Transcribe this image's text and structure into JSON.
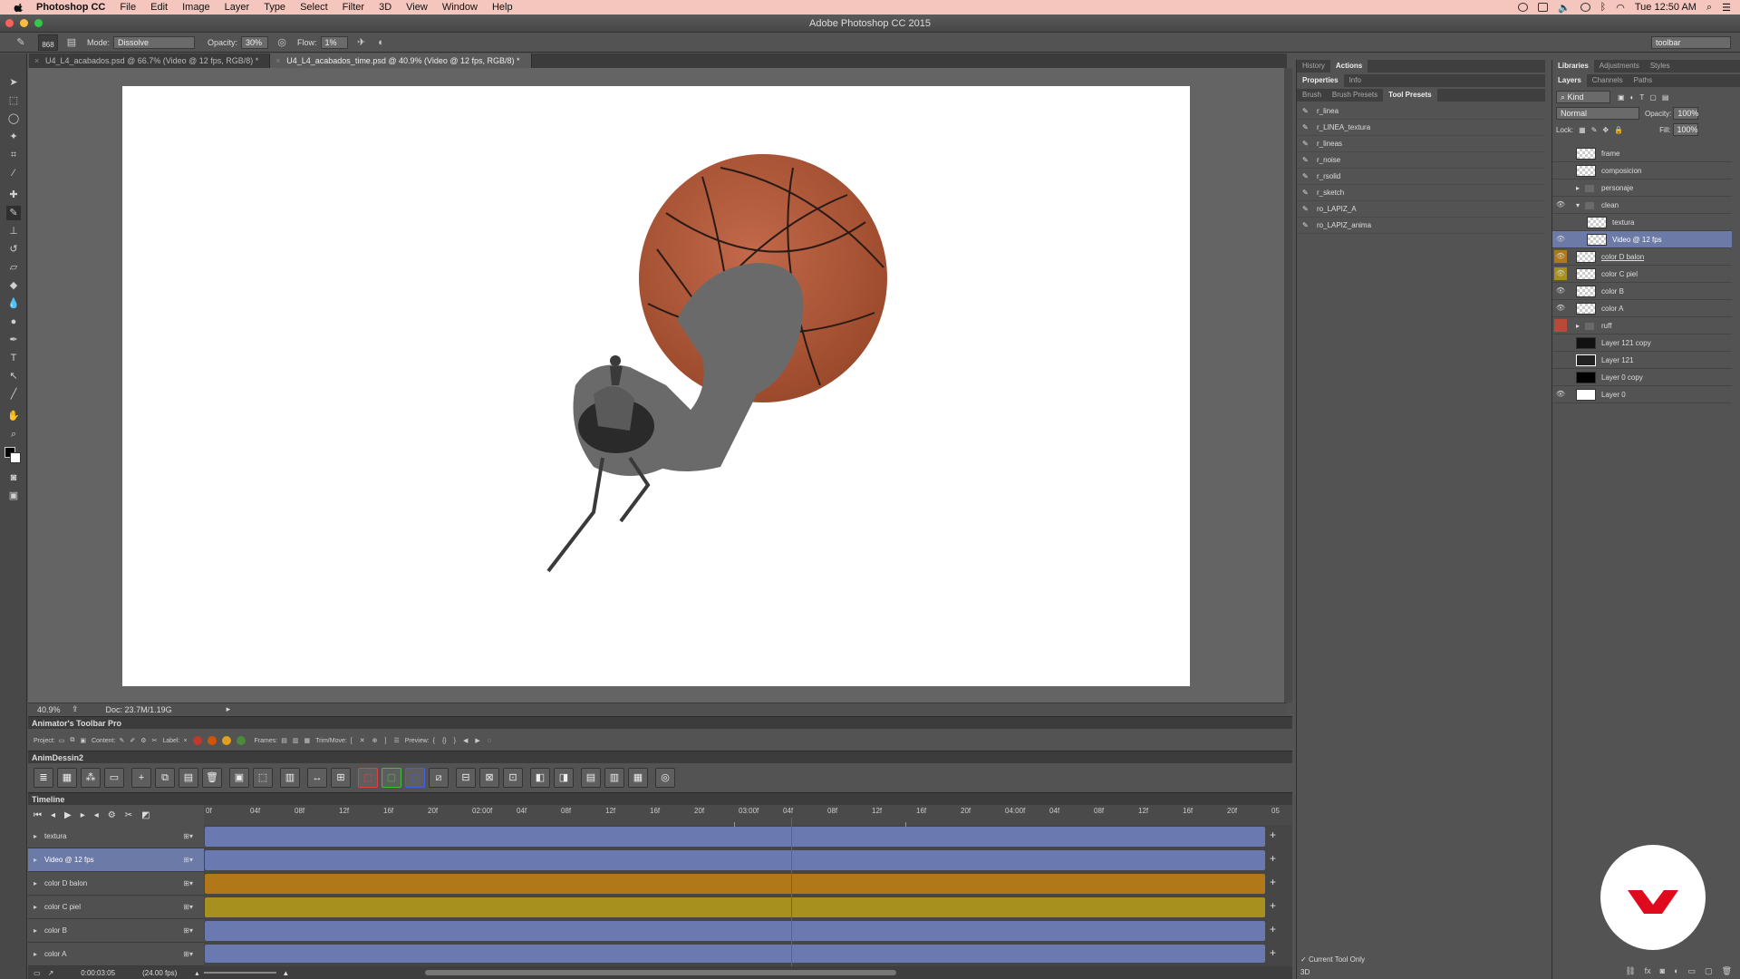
{
  "menubar": {
    "items": [
      "Photoshop CC",
      "File",
      "Edit",
      "Image",
      "Layer",
      "Type",
      "Select",
      "Filter",
      "3D",
      "View",
      "Window",
      "Help"
    ],
    "clock": "Tue 12:50 AM"
  },
  "window": {
    "title": "Adobe Photoshop CC 2015"
  },
  "options": {
    "brush_size": "868",
    "mode_label": "Mode:",
    "mode_value": "Dissolve",
    "opacity_label": "Opacity:",
    "opacity_value": "30%",
    "flow_label": "Flow:",
    "flow_value": "1%",
    "workspace": "toolbar"
  },
  "doc_tabs": [
    "U4_L4_acabados.psd @ 66.7% (Video @ 12 fps, RGB/8) *",
    "U4_L4_acabados_time.psd @ 40.9% (Video @ 12 fps, RGB/8) *"
  ],
  "status": {
    "zoom": "40.9%",
    "doc": "Doc: 23.7M/1.19G"
  },
  "animator": {
    "title": "Animator's Toolbar Pro",
    "project_label": "Project:",
    "content_label": "Content:",
    "label_label": "Label:",
    "frames_label": "Frames:",
    "trim_label": "Trim/Move:",
    "preview_label": "Preview:",
    "label_colors": [
      "#c0392b",
      "#d35400",
      "#e0a020",
      "#4a8a3a"
    ]
  },
  "animdessin": {
    "title": "AnimDessin2"
  },
  "timeline": {
    "title": "Timeline",
    "ruler": [
      "0f",
      "04f",
      "08f",
      "12f",
      "16f",
      "20f",
      "02:00f",
      "04f",
      "08f",
      "12f",
      "16f",
      "20f",
      "03:00f",
      "04f",
      "08f",
      "12f",
      "16f",
      "20f",
      "04:00f",
      "04f",
      "08f",
      "12f",
      "16f",
      "20f",
      "05"
    ],
    "rows": [
      {
        "name": "textura",
        "color": "#6a7ab0"
      },
      {
        "name": "Video @ 12 fps",
        "color": "#6a7ab0"
      },
      {
        "name": "color D balon",
        "color": "#b07818"
      },
      {
        "name": "color C piel",
        "color": "#a8901e"
      },
      {
        "name": "color B",
        "color": "#6a7ab0"
      },
      {
        "name": "color A",
        "color": "#6a7ab0"
      }
    ],
    "current_time": "0:00:03:05",
    "fps": "(24.00 fps)"
  },
  "mid_panel": {
    "tabs_top": [
      "History",
      "Actions"
    ],
    "tabs_mid": [
      "Properties",
      "Info"
    ],
    "tabs_low": [
      "Brush",
      "Brush Presets",
      "Tool Presets"
    ],
    "presets": [
      "r_linea",
      "r_LINEA_textura",
      "r_lineas",
      "r_noise",
      "r_rsolid",
      "r_sketch",
      "ro_LAPIZ_A",
      "ro_LAPIZ_anima"
    ],
    "current_tool_only": "Current Tool Only"
  },
  "right_panel": {
    "tabs_top": [
      "Libraries",
      "Adjustments",
      "Styles"
    ],
    "tabs_mid": [
      "Layers",
      "Channels",
      "Paths"
    ],
    "kind": "Kind",
    "blend": "Normal",
    "opacity_label": "Opacity:",
    "opacity_value": "100%",
    "lock_label": "Lock:",
    "fill_label": "Fill:",
    "fill_value": "100%",
    "layers": [
      {
        "name": "frame",
        "type": "checker"
      },
      {
        "name": "composicion",
        "type": "checker"
      },
      {
        "name": "personaje",
        "type": "folder"
      },
      {
        "name": "clean",
        "type": "folder"
      },
      {
        "name": "textura",
        "type": "checker"
      },
      {
        "name": "Video @ 12 fps",
        "type": "checker"
      },
      {
        "name": "color D balon",
        "type": "checker"
      },
      {
        "name": "color C piel",
        "type": "checker"
      },
      {
        "name": "color B",
        "type": "checker"
      },
      {
        "name": "color A",
        "type": "checker"
      },
      {
        "name": "ruff",
        "type": "folder"
      },
      {
        "name": "Layer 121 copy",
        "type": "dark"
      },
      {
        "name": "Layer 121",
        "type": "dark"
      },
      {
        "name": "Layer 0 copy",
        "type": "black"
      },
      {
        "name": "Layer 0",
        "type": "white"
      }
    ]
  },
  "bottom_left": "3D",
  "colors": {
    "timeline_blue": "#6a7ab0",
    "timeline_orange": "#b07818",
    "timeline_gold": "#a8901e",
    "ball": "#b05a38",
    "figure": "#6a6a6a",
    "logo_red": "#e00a1e"
  }
}
